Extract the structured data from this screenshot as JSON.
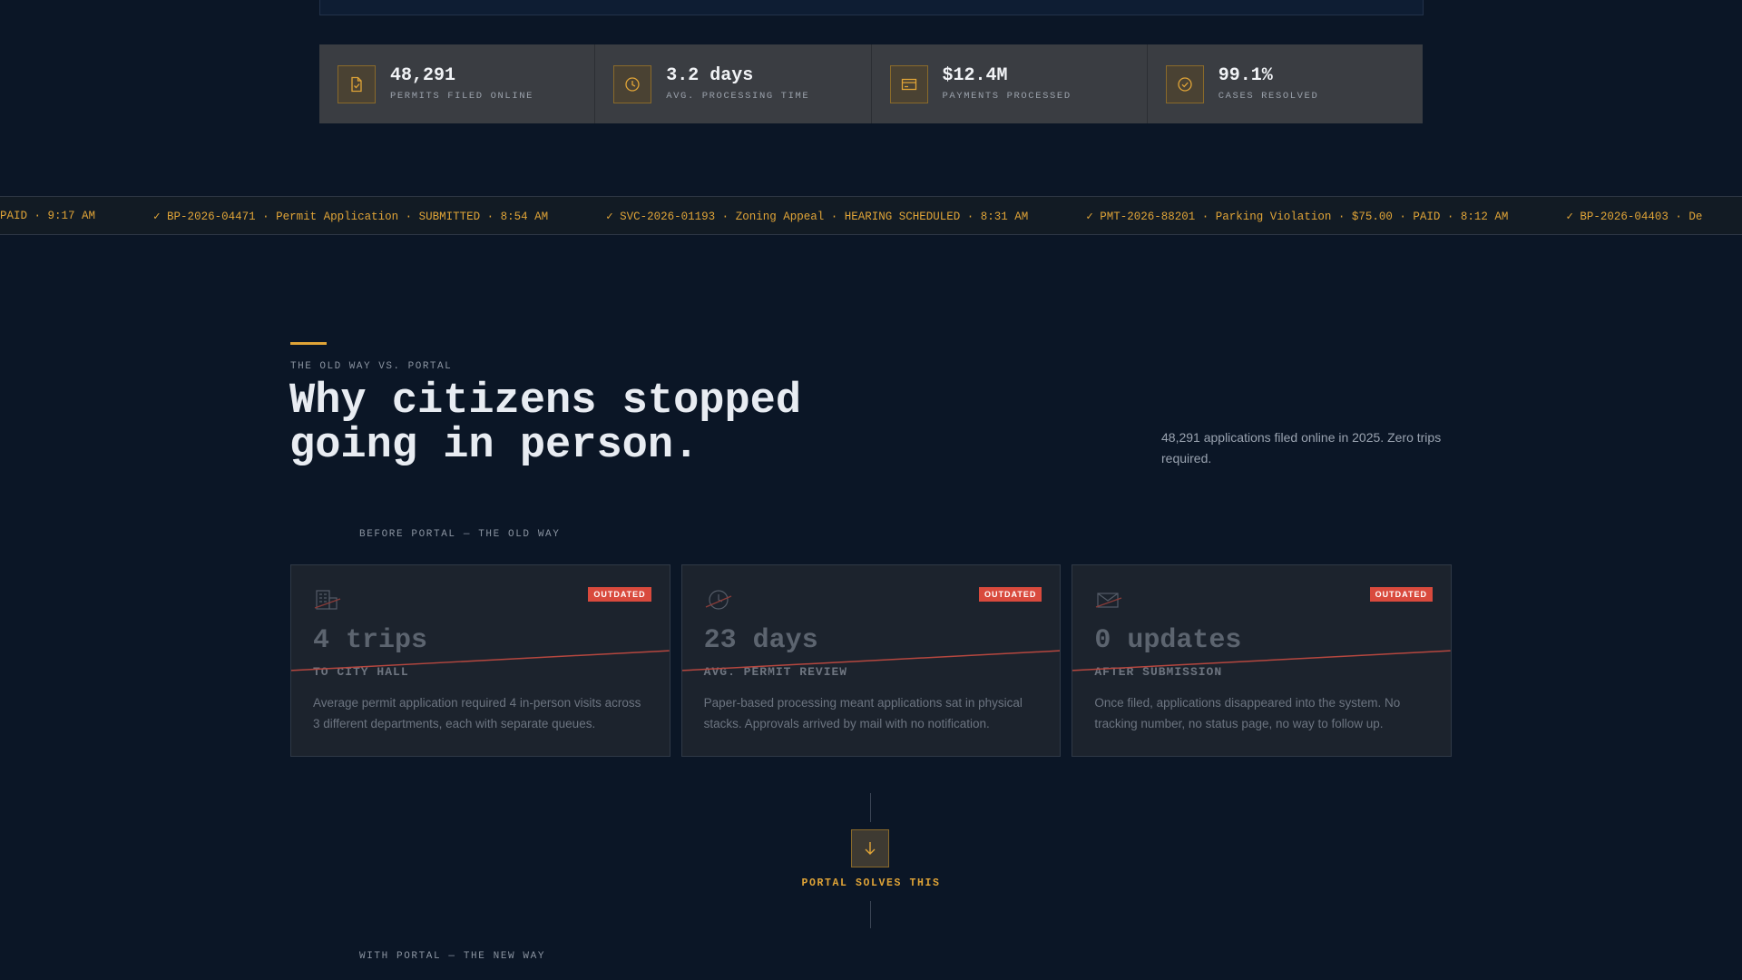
{
  "stats": [
    {
      "value": "48,291",
      "label": "PERMITS FILED ONLINE",
      "icon": "document-check-icon"
    },
    {
      "value": "3.2 days",
      "label": "AVG. PROCESSING TIME",
      "icon": "clock-icon"
    },
    {
      "value": "$12.4M",
      "label": "PAYMENTS PROCESSED",
      "icon": "credit-card-icon"
    },
    {
      "value": "99.1%",
      "label": "CASES RESOLVED",
      "icon": "check-circle-icon"
    }
  ],
  "ticker": [
    "PAID · 9:17 AM",
    "✓ BP-2026-04471 · Permit Application · SUBMITTED · 8:54 AM",
    "✓ SVC-2026-01193 · Zoning Appeal · HEARING SCHEDULED · 8:31 AM",
    "✓ PMT-2026-88201 · Parking Violation · $75.00 · PAID · 8:12 AM",
    "✓ BP-2026-04403 · De"
  ],
  "section": {
    "eyebrow": "THE OLD WAY VS. PORTAL",
    "title_line1": "Why citizens stopped",
    "title_line2": "going in person.",
    "side_note": "48,291 applications filed online in 2025. Zero trips required.",
    "before_label": "BEFORE PORTAL — THE OLD WAY",
    "after_label": "WITH PORTAL — THE NEW WAY"
  },
  "old_cards": [
    {
      "icon": "building-icon",
      "badge": "OUTDATED",
      "value": "4 trips",
      "sub": "TO CITY HALL",
      "desc": "Average permit application required 4 in-person visits across 3 different departments, each with separate queues."
    },
    {
      "icon": "clock-icon",
      "badge": "OUTDATED",
      "value": "23 days",
      "sub": "AVG. PERMIT REVIEW",
      "desc": "Paper-based processing meant applications sat in physical stacks. Approvals arrived by mail with no notification."
    },
    {
      "icon": "envelope-icon",
      "badge": "OUTDATED",
      "value": "0 updates",
      "sub": "AFTER SUBMISSION",
      "desc": "Once filed, applications disappeared into the system. No tracking number, no status page, no way to follow up."
    }
  ],
  "transition": {
    "label": "PORTAL SOLVES THIS",
    "icon": "arrow-down-icon"
  },
  "colors": {
    "accent": "#e0a437",
    "background": "#0b1626",
    "outdated": "#d94a3d"
  }
}
